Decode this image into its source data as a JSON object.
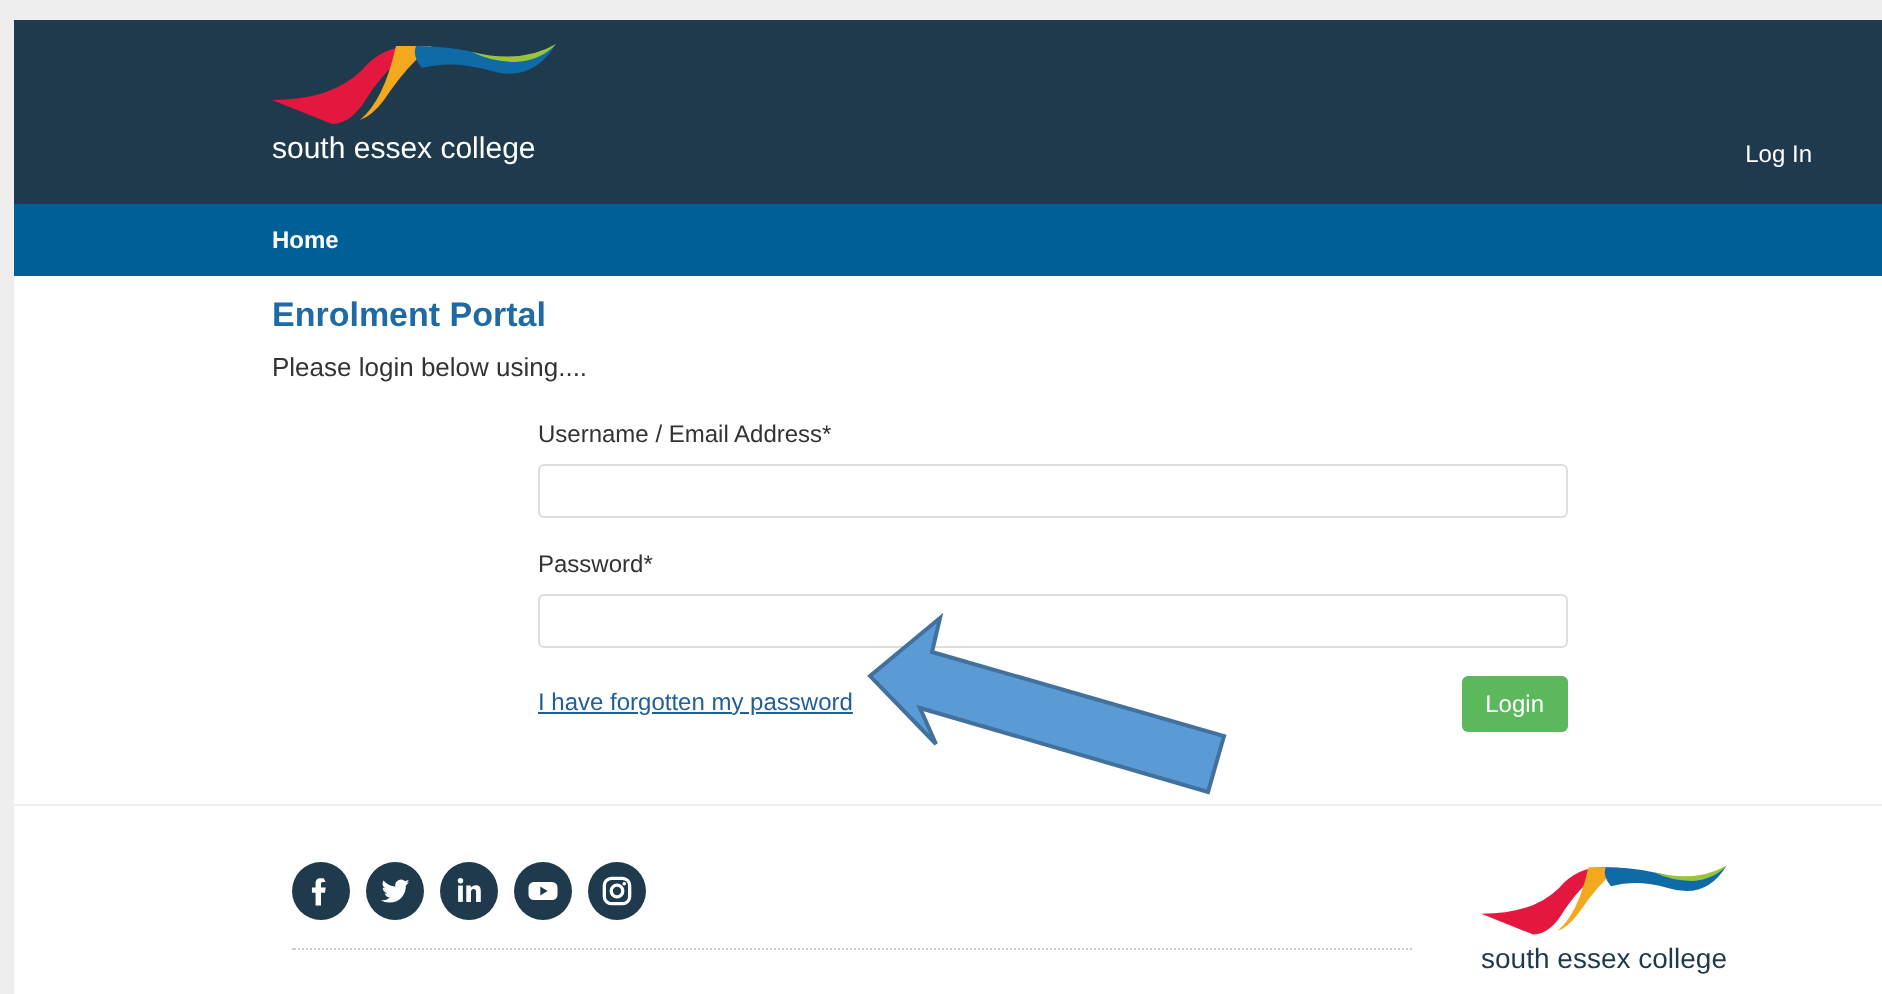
{
  "header": {
    "logo_text": "south essex college",
    "login_link": "Log In"
  },
  "nav": {
    "items": [
      "Home"
    ]
  },
  "title": "Enrolment Portal",
  "intro": "Please login below using....",
  "form": {
    "fields": [
      {
        "label": "Username / Email Address*"
      },
      {
        "label": "Password*"
      }
    ],
    "forgot_link": "I have forgotten my password",
    "submit": "Login"
  },
  "footer": {
    "logo_text": "south essex college"
  }
}
